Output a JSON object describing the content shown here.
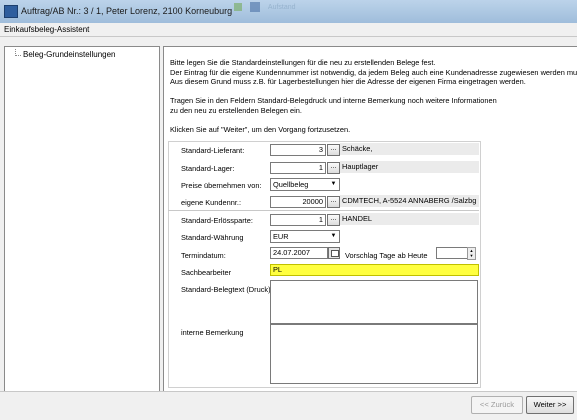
{
  "window": {
    "title": "Auftrag/AB Nr.: 3 / 1, Peter Lorenz, 2100  Korneuburg",
    "background_strip_text": "Aufstand"
  },
  "dialog": {
    "title": "Einkaufsbeleg-Assistent"
  },
  "tree": {
    "items": [
      "Beleg-Grundeinstellungen"
    ]
  },
  "info": {
    "lines": [
      "Bitte legen Sie die Standardeinstellungen für die neu zu erstellenden Belege fest.",
      "Der Eintrag für die eigene Kundennummer ist notwendig, da jedem Beleg auch eine Kundenadresse zugewiesen werden muss.",
      "Aus diesem Grund muss  z.B. für Lagerbestellungen hier die Adresse der eigenen Firma eingetragen werden.",
      "",
      "Tragen Sie in den Feldern Standard-Belegdruck und interne Bemerkung noch weitere Informationen",
      "zu den neu zu erstellenden Belegen ein.",
      "",
      "Klicken Sie auf \"Weiter\", um den Vorgang fortzusetzen."
    ]
  },
  "form": {
    "lieferant": {
      "label": "Standard-Lieferant:",
      "value": "3",
      "button": "...",
      "description": "Schäcke,"
    },
    "lager": {
      "label": "Standard-Lager:",
      "value": "1",
      "button": "...",
      "description": "Hauptlager"
    },
    "preise": {
      "label": "Preise übernehmen von:",
      "selected": "Quellbeleg"
    },
    "kundennr": {
      "label": "eigene Kundennr.:",
      "value": "20000",
      "button": "...",
      "description": "CDMTECH, A-5524 ANNABERG /Salzbg"
    },
    "erloessparte": {
      "label": "Standard-Erlössparte:",
      "value": "1",
      "button": "...",
      "description": "HANDEL"
    },
    "waehrung": {
      "label": "Standard-Währung",
      "selected": "EUR"
    },
    "termindatum": {
      "label": "Termindatum:",
      "value": "24.07.2007"
    },
    "vorschlag": {
      "label": "Vorschlag Tage ab Heute",
      "value": ""
    },
    "sachbearbeiter": {
      "label": "Sachbearbeiter",
      "value": "PL"
    },
    "belegtext": {
      "label": "Standard-Belegtext (Druck):",
      "value": ""
    },
    "bemerkung": {
      "label": "interne Bemerkung",
      "value": ""
    }
  },
  "buttons": {
    "back": "<< Zurück",
    "next": "Weiter >>"
  },
  "icons": {
    "app": "app-document-icon",
    "dropdown": "chevron-down-icon",
    "calendar": "calendar-icon",
    "spinner": "spinner-arrows-icon"
  },
  "colors": {
    "highlight": "#ffff40",
    "titlebar": "#9fbddb"
  }
}
